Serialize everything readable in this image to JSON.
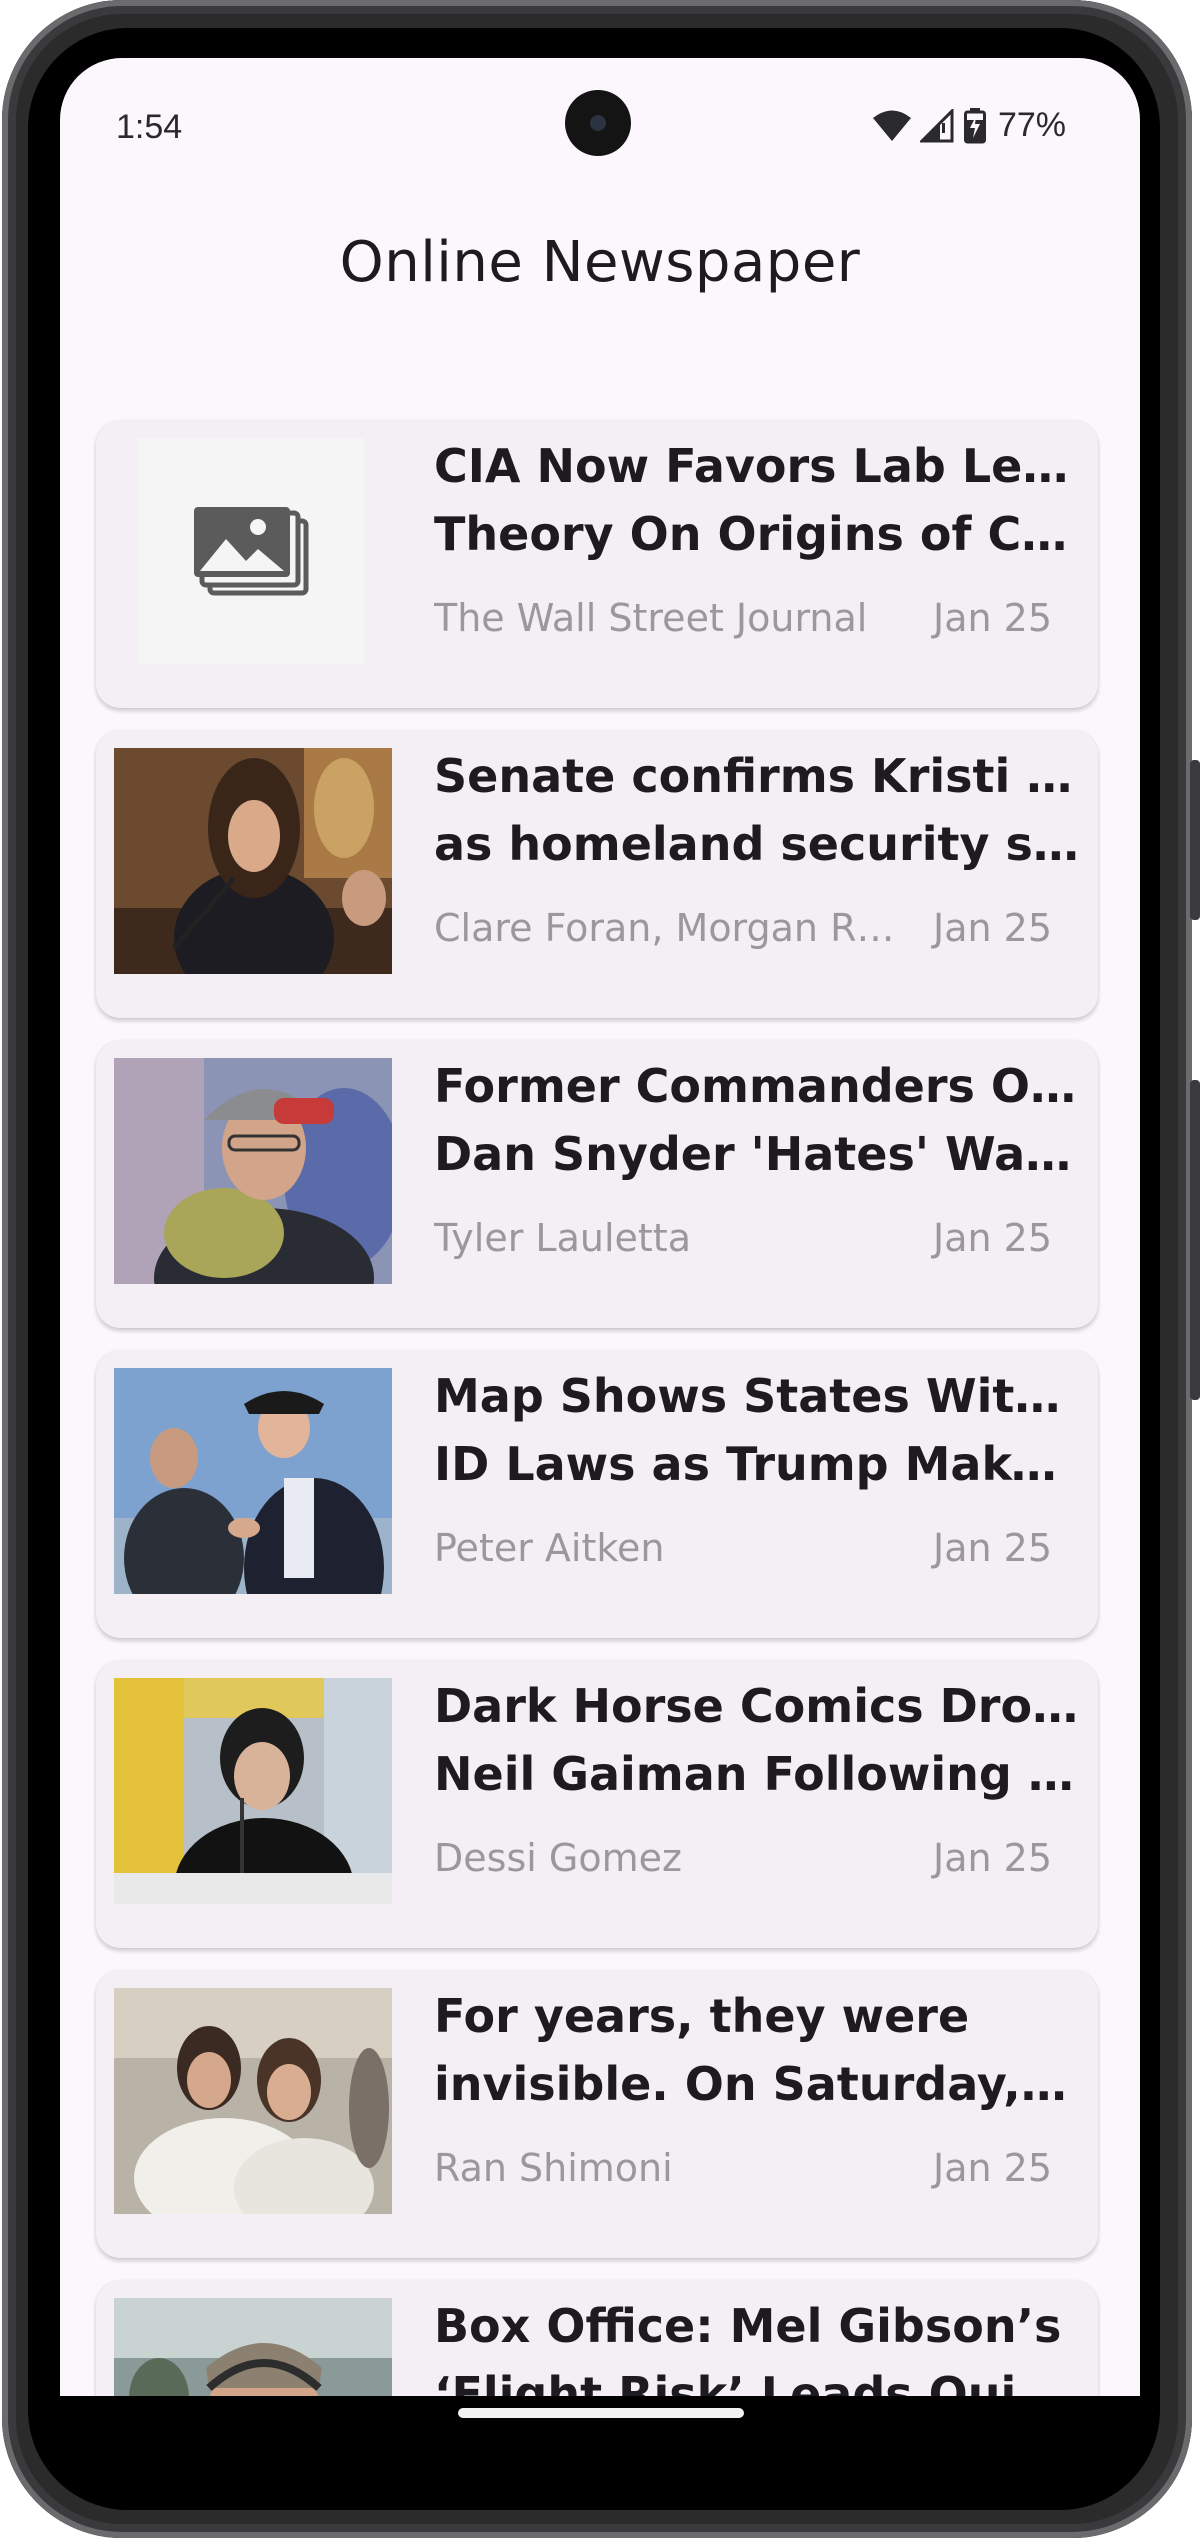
{
  "status_bar": {
    "time": "1:54",
    "battery": "77%",
    "icons": [
      "wifi-icon",
      "cell-signal-icon",
      "battery-charging-icon"
    ]
  },
  "app": {
    "title": "Online Newspaper"
  },
  "articles": [
    {
      "headline_line1": "CIA Now Favors Lab Leak",
      "headline_line2": "Theory On Origins of Covid-…",
      "author": "The Wall Street Journal",
      "date": "Jan 25",
      "image": "image-placeholder-icon"
    },
    {
      "headline_line1": "Senate confirms Kristi Noem",
      "headline_line2": "as homeland security secre…",
      "author": "Clare Foran, Morgan Rim…",
      "date": "Jan 25",
      "image": "photo"
    },
    {
      "headline_line1": "Former Commanders Owner",
      "headline_line2": "Dan Snyder 'Hates' Washing…",
      "author": "Tyler Lauletta",
      "date": "Jan 25",
      "image": "photo"
    },
    {
      "headline_line1": "Map Shows States With Voter",
      "headline_line2": "ID Laws as Trump Makes D…",
      "author": "Peter Aitken",
      "date": "Jan 25",
      "image": "photo"
    },
    {
      "headline_line1": "Dark Horse Comics Drops",
      "headline_line2": "Neil Gaiman Following Sexu…",
      "author": "Dessi Gomez",
      "date": "Jan 25",
      "image": "photo"
    },
    {
      "headline_line1": "For years, they were",
      "headline_line2": "invisible. On Saturday, all of…",
      "author": "Ran Shimoni",
      "date": "Jan 25",
      "image": "photo"
    },
    {
      "headline_line1": "Box Office: Mel Gibson’s",
      "headline_line2": "‘Flight Risk’ Leads Quiet We…",
      "author": "",
      "date": "",
      "image": "photo"
    }
  ],
  "colors": {
    "screen_background": "#fcf7fc",
    "card_background": "#f4eff4",
    "headline": "#1d1b20",
    "meta_text": "#9b979d"
  }
}
